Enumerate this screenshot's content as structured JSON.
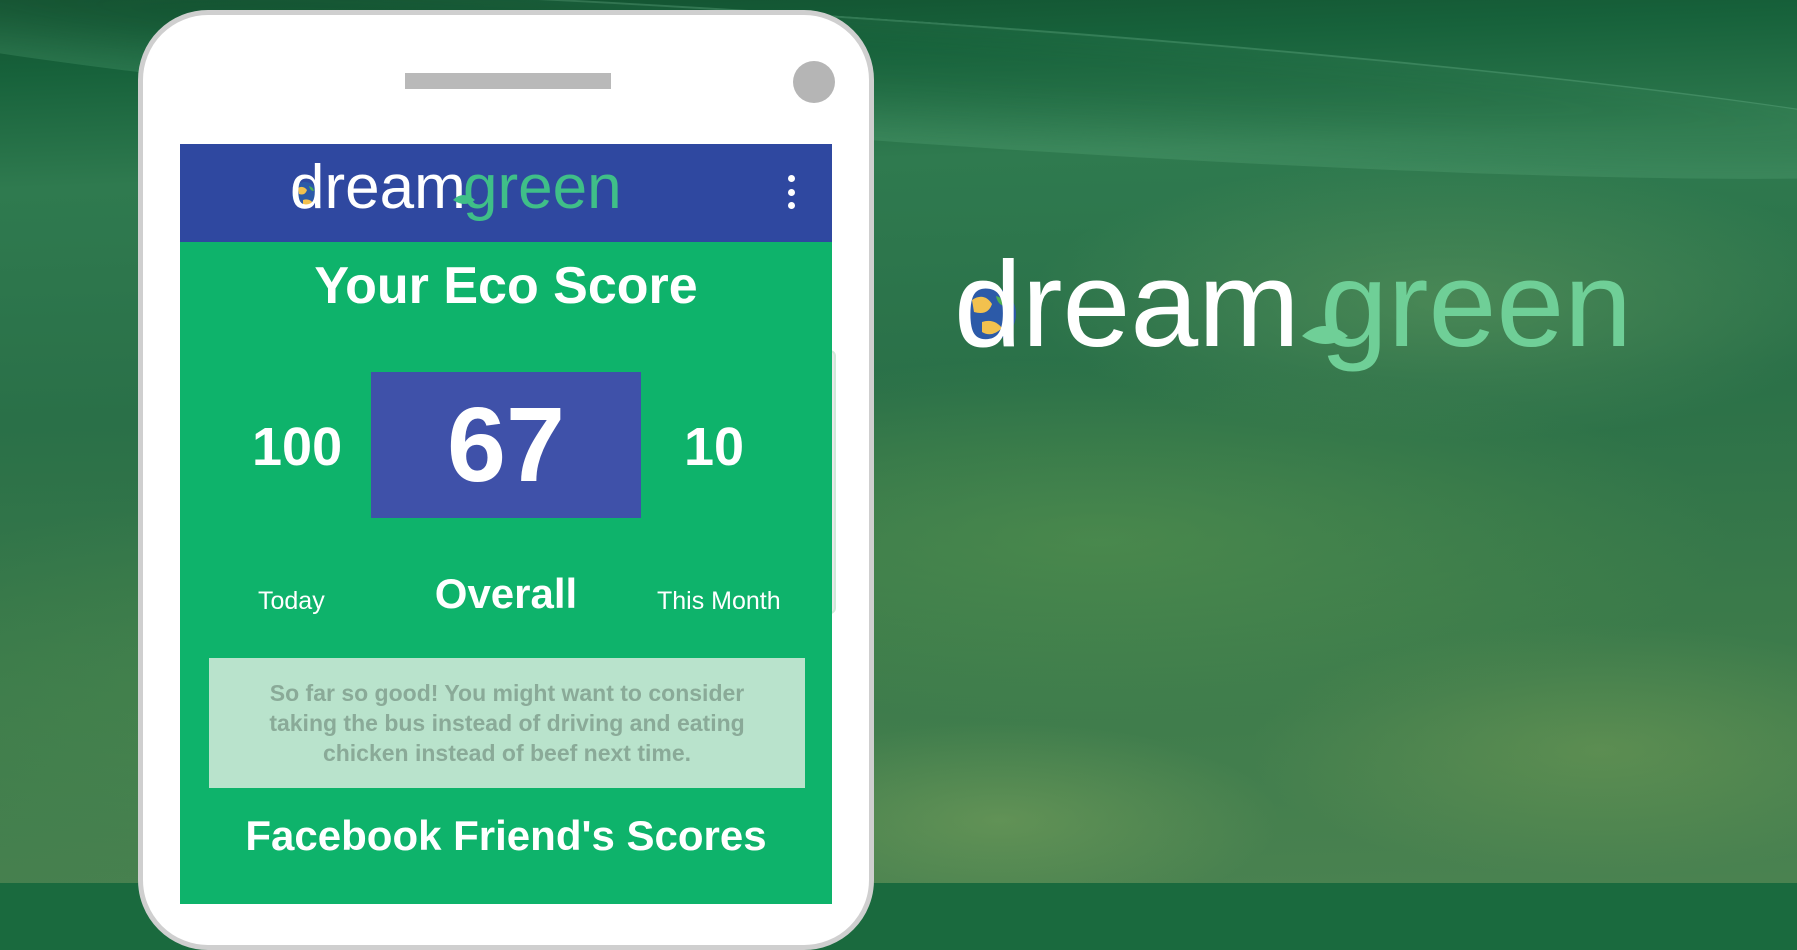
{
  "brand": {
    "word_dream": "dream",
    "word_green": "green",
    "colors": {
      "dream": "#ffffff",
      "green_light": "#6fcf97",
      "green_app": "#3fbf88"
    }
  },
  "app": {
    "header_color": "#2f48a0",
    "screen_color": "#0eb36b",
    "menu_icon": "more-vert-icon",
    "eco_title": "Your Eco Score",
    "scores": {
      "today": "100",
      "overall": "67",
      "month": "10"
    },
    "labels": {
      "today": "Today",
      "overall": "Overall",
      "month": "This Month"
    },
    "advice": "So far so good! You might want to consider taking the bus instead of driving and eating chicken instead of beef next time.",
    "friends_title": "Facebook Friend's Scores"
  }
}
